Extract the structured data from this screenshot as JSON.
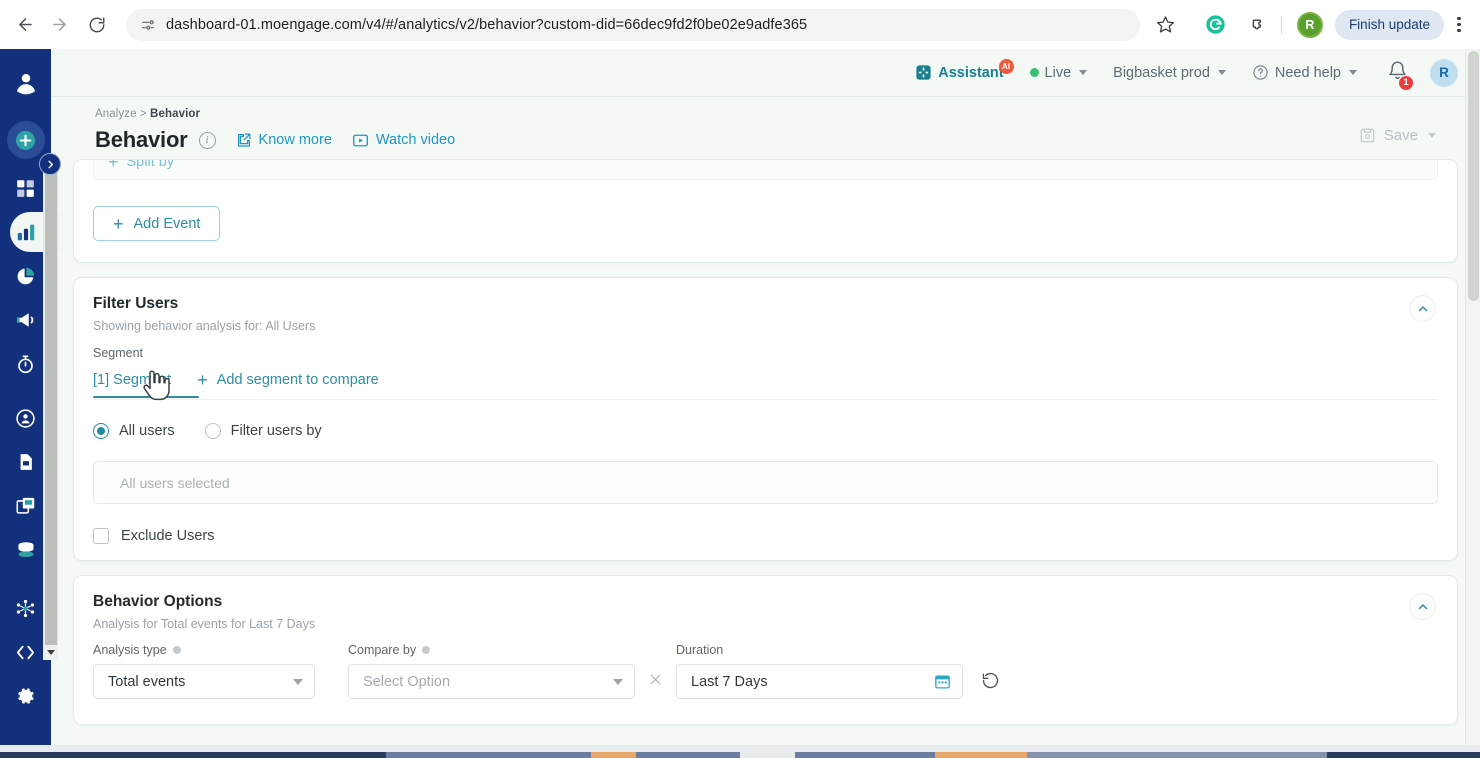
{
  "browser": {
    "url": "dashboard-01.moengage.com/v4/#/analytics/v2/behavior?custom-did=66dec9fd2f0be02e9adfe365",
    "back_icon": "back-arrow-icon",
    "forward_icon": "forward-arrow-icon",
    "reload_icon": "reload-icon",
    "site_info_icon": "site-settings-icon",
    "bookmark_icon": "star-icon",
    "grammarly_icon": "grammarly-extension-icon",
    "extensions_icon": "extensions-puzzle-icon",
    "profile_initial": "R",
    "finish_update_label": "Finish update",
    "menu_icon": "three-dot-menu-icon"
  },
  "sidebar": {
    "items": [
      {
        "name": "account-avatar",
        "icon": "user-circle-icon"
      },
      {
        "name": "create-new",
        "icon": "plus-circle-icon"
      },
      {
        "name": "dashboard",
        "icon": "grid-dashboard-icon"
      },
      {
        "name": "analytics",
        "icon": "bar-chart-icon",
        "active": true
      },
      {
        "name": "insights",
        "icon": "pie-chart-icon"
      },
      {
        "name": "campaigns",
        "icon": "megaphone-icon"
      },
      {
        "name": "automation",
        "icon": "stopwatch-icon"
      },
      {
        "name": "users",
        "icon": "user-shield-icon"
      },
      {
        "name": "content",
        "icon": "document-icon"
      },
      {
        "name": "templates",
        "icon": "layers-icon"
      },
      {
        "name": "data",
        "icon": "database-icon"
      },
      {
        "name": "integrations",
        "icon": "network-nodes-icon"
      },
      {
        "name": "developer",
        "icon": "code-brackets-icon"
      },
      {
        "name": "settings",
        "icon": "gear-icon"
      }
    ],
    "expand_icon": "chevron-right-expand-icon"
  },
  "header": {
    "assistant_label": "Assistant",
    "assistant_badge": "AI",
    "live_label": "Live",
    "workspace_label": "Bigbasket prod",
    "help_label": "Need help",
    "notification_count": "1",
    "user_initial": "R",
    "assistant_icon": "assistant-sparkle-icon",
    "help_icon": "question-circle-icon",
    "bell_icon": "notification-bell-icon"
  },
  "page": {
    "breadcrumb_root": "Analyze",
    "breadcrumb_sep": ">",
    "breadcrumb_current": "Behavior",
    "title": "Behavior",
    "info_icon": "info-circle-icon",
    "know_more_label": "Know more",
    "know_more_icon": "external-link-icon",
    "watch_video_label": "Watch video",
    "watch_video_icon": "video-play-icon",
    "save_label": "Save",
    "save_icon": "floppy-disk-icon"
  },
  "events_card": {
    "split_by_label": "Split by",
    "add_event_label": "Add Event",
    "plus": "+"
  },
  "filter_users": {
    "title": "Filter Users",
    "subtitle": "Showing behavior analysis for: All Users",
    "segment_label": "Segment",
    "tab_label": "[1] Segment",
    "add_segment_label": "Add segment to compare",
    "plus": "+",
    "radio_all_users": "All users",
    "radio_filter_users_by": "Filter users by",
    "selected_value": "All users selected",
    "exclude_label": "Exclude Users",
    "collapse_icon": "chevron-up-icon"
  },
  "behavior_options": {
    "title": "Behavior Options",
    "subtitle": "Analysis for Total events for Last 7 Days",
    "analysis_type_label": "Analysis type",
    "analysis_type_value": "Total events",
    "compare_by_label": "Compare by",
    "compare_by_placeholder": "Select Option",
    "duration_label": "Duration",
    "duration_value": "Last 7 Days",
    "clear_icon": "close-x-icon",
    "calendar_icon": "calendar-icon",
    "reset_icon": "reset-refresh-icon",
    "collapse_icon": "chevron-up-icon"
  },
  "colors": {
    "brand_navy": "#13307d",
    "accent_teal": "#2d8fa0",
    "link_blue": "#2196c4",
    "page_bg": "#f4f9f6",
    "live_green": "#38c172",
    "badge_red": "#ee3b3b"
  }
}
